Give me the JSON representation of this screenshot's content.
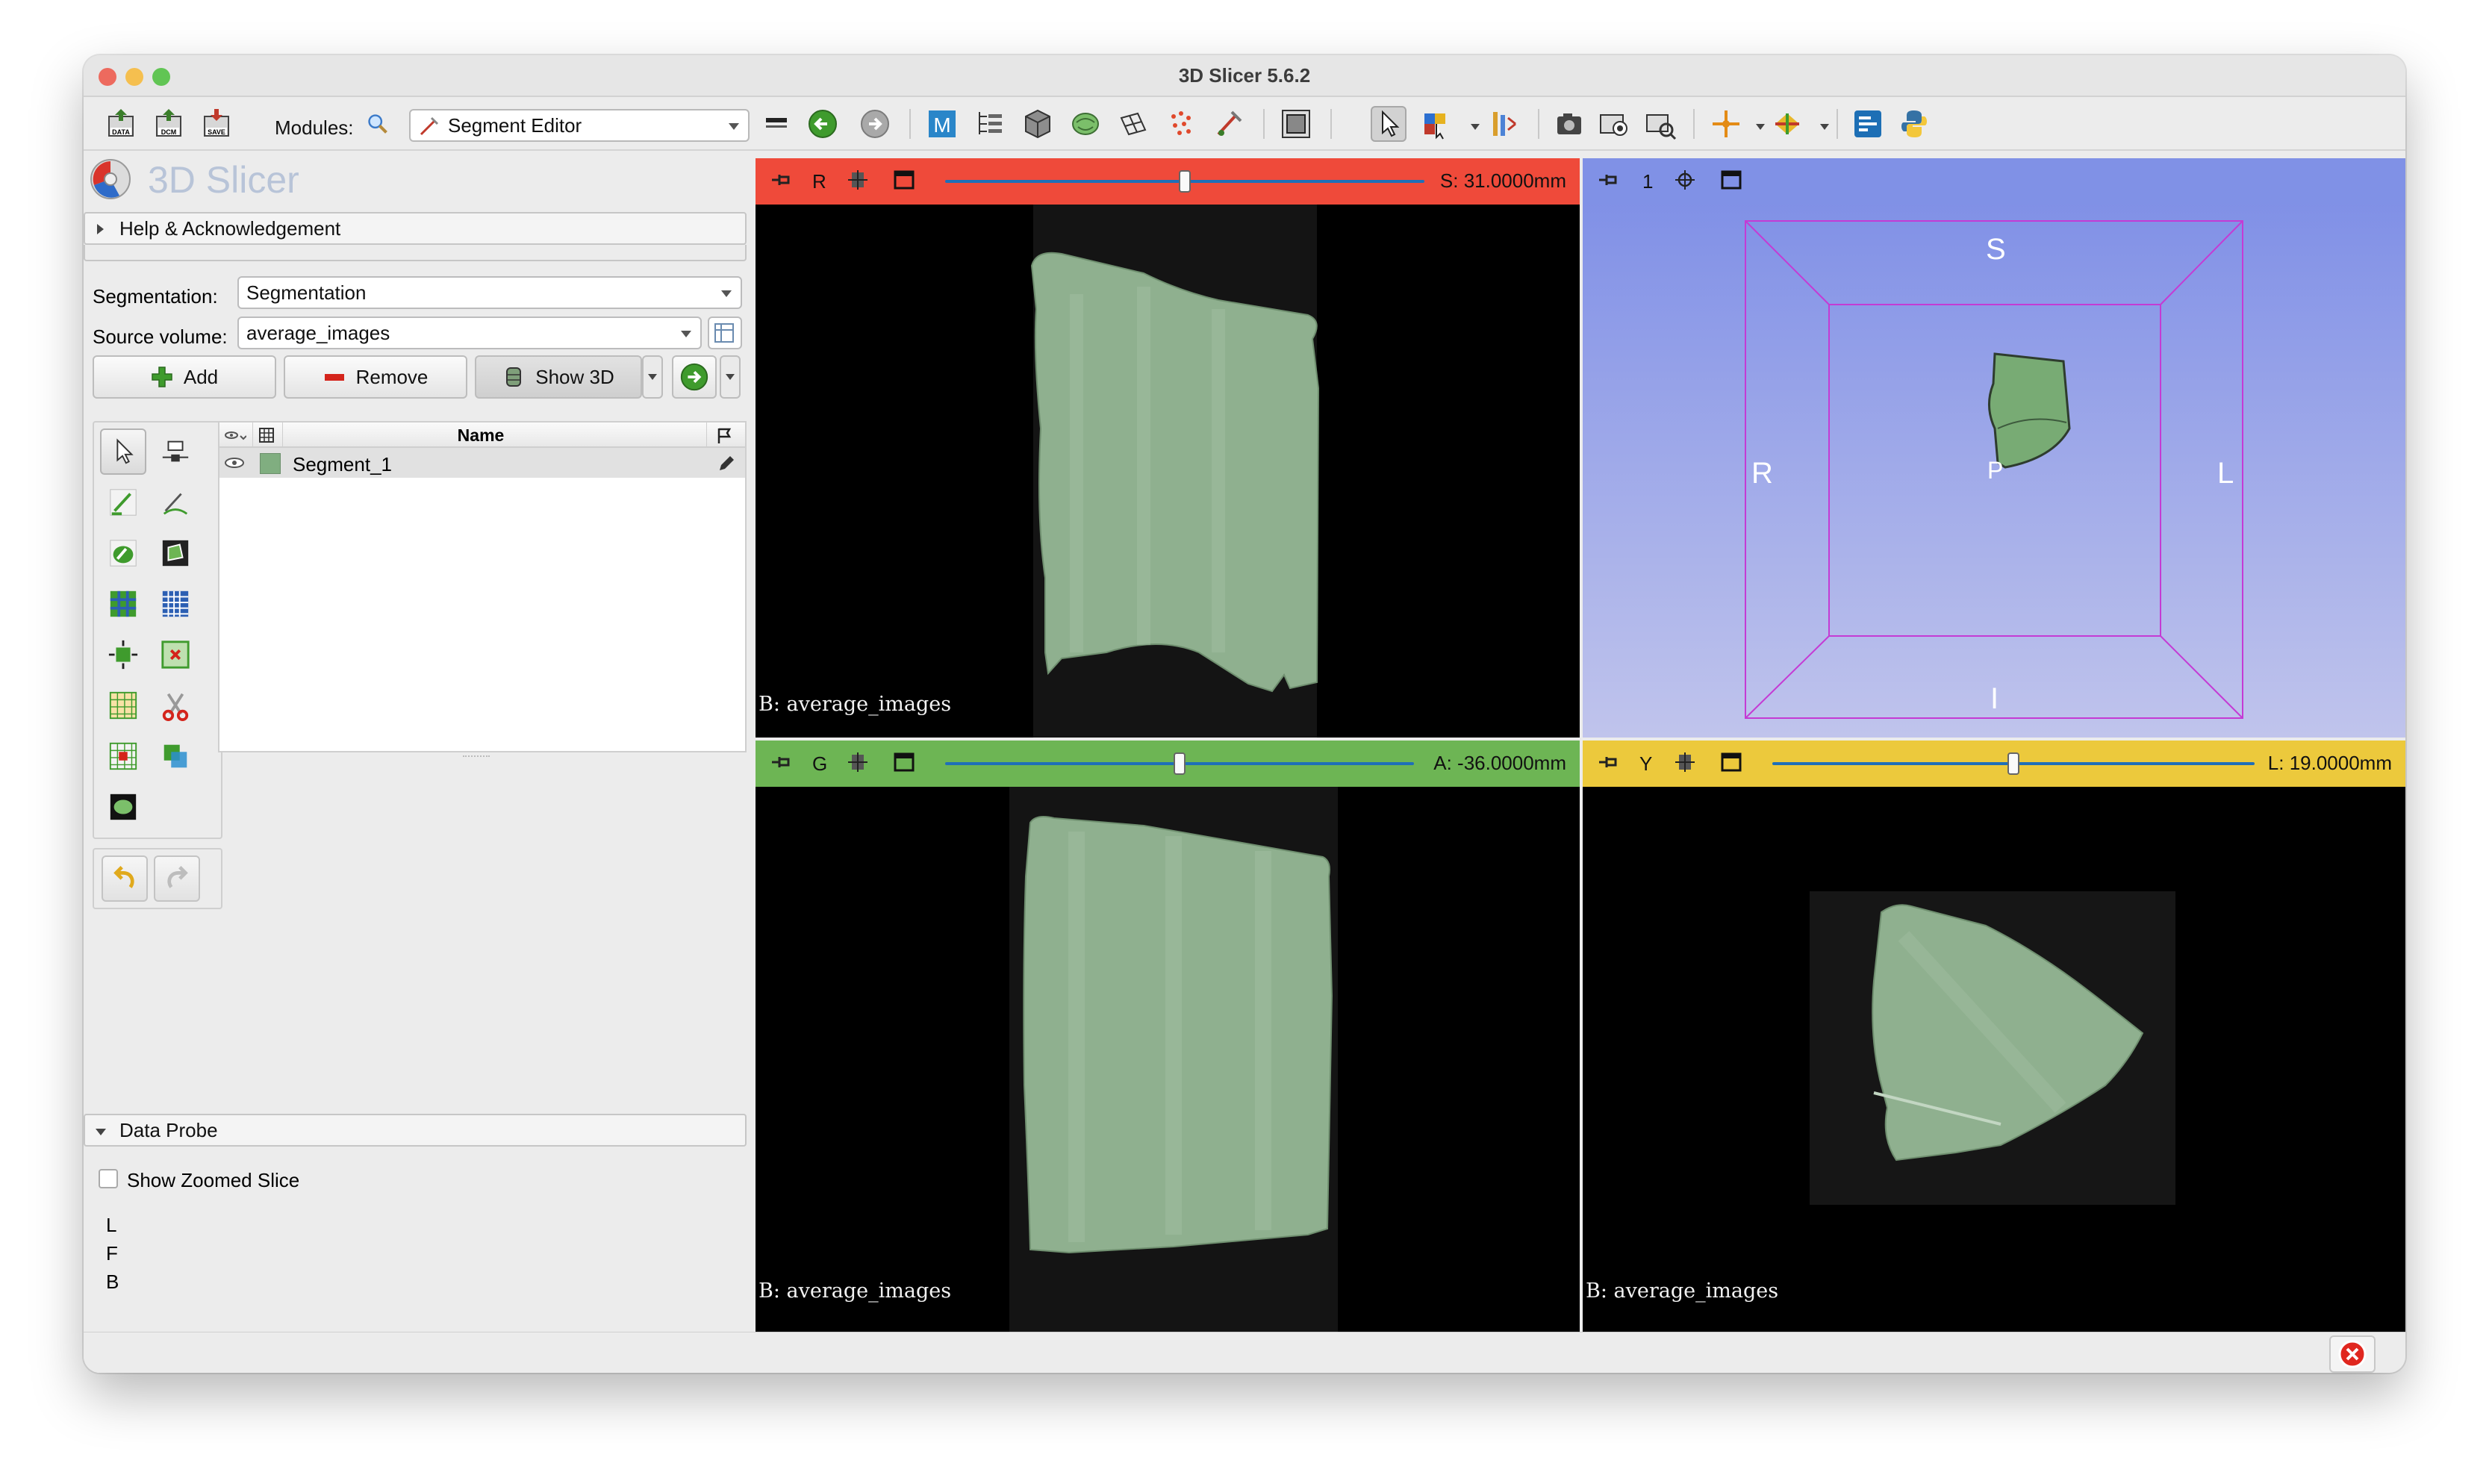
{
  "window": {
    "title": "3D Slicer 5.6.2",
    "traffic": {
      "close": "#ed6a5e",
      "min": "#f5bf4f",
      "max": "#61c554"
    }
  },
  "toolbar": {
    "modules_label": "Modules:",
    "module_selected": "Segment Editor"
  },
  "panel": {
    "logo_text": "3D Slicer",
    "help_section": "Help & Acknowledgement",
    "segmentation_label": "Segmentation:",
    "segmentation_value": "Segmentation",
    "source_volume_label": "Source volume:",
    "source_volume_value": "average_images",
    "add_label": "Add",
    "remove_label": "Remove",
    "show3d_label": "Show 3D",
    "table": {
      "name_header": "Name",
      "rows": [
        {
          "name": "Segment_1",
          "color": "#80ae80"
        }
      ]
    },
    "data_probe": "Data Probe",
    "show_zoomed_slice": "Show Zoomed Slice",
    "probe_lines": [
      "L",
      "F",
      "B"
    ]
  },
  "views": {
    "red": {
      "label": "R",
      "value": "S: 31.0000mm",
      "caption": "B: average_images",
      "bar_color": "#ef4a3a",
      "slider_fraction": 0.5
    },
    "green": {
      "label": "G",
      "value": "A: -36.0000mm",
      "caption": "B: average_images",
      "bar_color": "#6db554",
      "slider_fraction": 0.5
    },
    "yellow": {
      "label": "Y",
      "value": "L: 19.0000mm",
      "caption": "B: average_images",
      "bar_color": "#ecc93c",
      "slider_fraction": 0.5
    },
    "threed": {
      "label": "1",
      "bar_color": "#8091e6",
      "orient": {
        "s": "S",
        "r": "R",
        "l": "L",
        "p": "P",
        "i": "I"
      }
    }
  }
}
